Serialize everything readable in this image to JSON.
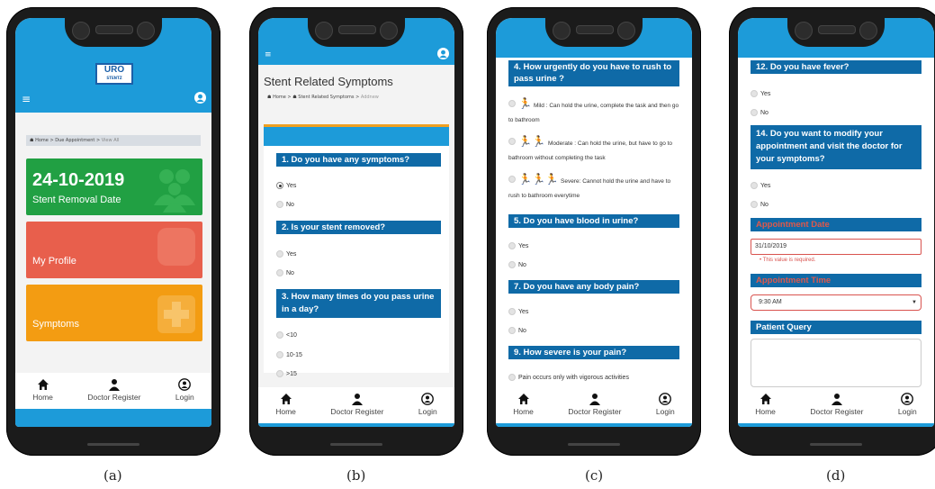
{
  "nav": {
    "home": "Home",
    "doctor_register": "Doctor Register",
    "login": "Login"
  },
  "captions": [
    "(a)",
    "(b)",
    "(c)",
    "(d)"
  ],
  "screen_a": {
    "logo_line1": "URO",
    "logo_line2": "STENTZ",
    "breadcrumb": {
      "home": "Home",
      "sep": ">",
      "mid": "Due Appointment",
      "last": "View All"
    },
    "tiles": [
      {
        "title": "24-10-2019",
        "subtitle": "Stent Removal Date",
        "color": "#21a043"
      },
      {
        "title": "My Profile",
        "color": "#e85f4c"
      },
      {
        "title": "Symptoms",
        "color": "#f39c12"
      }
    ]
  },
  "screen_b": {
    "page_title": "Stent Related Symptoms",
    "breadcrumb": {
      "home": "Home",
      "mid": "Stent Related Symptoms",
      "last": "Addnew"
    },
    "questions": [
      {
        "q": "1. Do you have any symptoms?",
        "options": [
          "Yes",
          "No"
        ],
        "selected": 0
      },
      {
        "q": "2. Is your stent removed?",
        "options": [
          "Yes",
          "No"
        ]
      },
      {
        "q": "3. How many times do you pass urine in a day?",
        "options": [
          "<10",
          "10-15",
          ">15"
        ]
      }
    ]
  },
  "screen_c": {
    "q4": "4. How urgently do you have to rush to pass urine ?",
    "mild": "Mild : Can hold the urine, complete the task and then go to bathroom",
    "moderate": "Moderate : Can hold the urine, but have to go to bathroom without completing the task",
    "severe": "Severe: Cannot hold the urine and have to rush to bathroom everytime",
    "q5": "5. Do you have blood in urine?",
    "q7": "7. Do you have any body pain?",
    "q9": "9. How severe is your pain?",
    "yes": "Yes",
    "no": "No",
    "pain_opt": "Pain occurs only with vigorous activities"
  },
  "screen_d": {
    "q12": "12. Do you have fever?",
    "q14": "14. Do you want to modify your appointment and visit the doctor for your symptoms?",
    "yes": "Yes",
    "no": "No",
    "appointment_date_label": "Appointment Date",
    "appointment_date_value": "31/10/2019",
    "error": "This value is required.",
    "appointment_time_label": "Appointment Time",
    "appointment_time_value": "9:30 AM",
    "patient_query_label": "Patient Query"
  }
}
